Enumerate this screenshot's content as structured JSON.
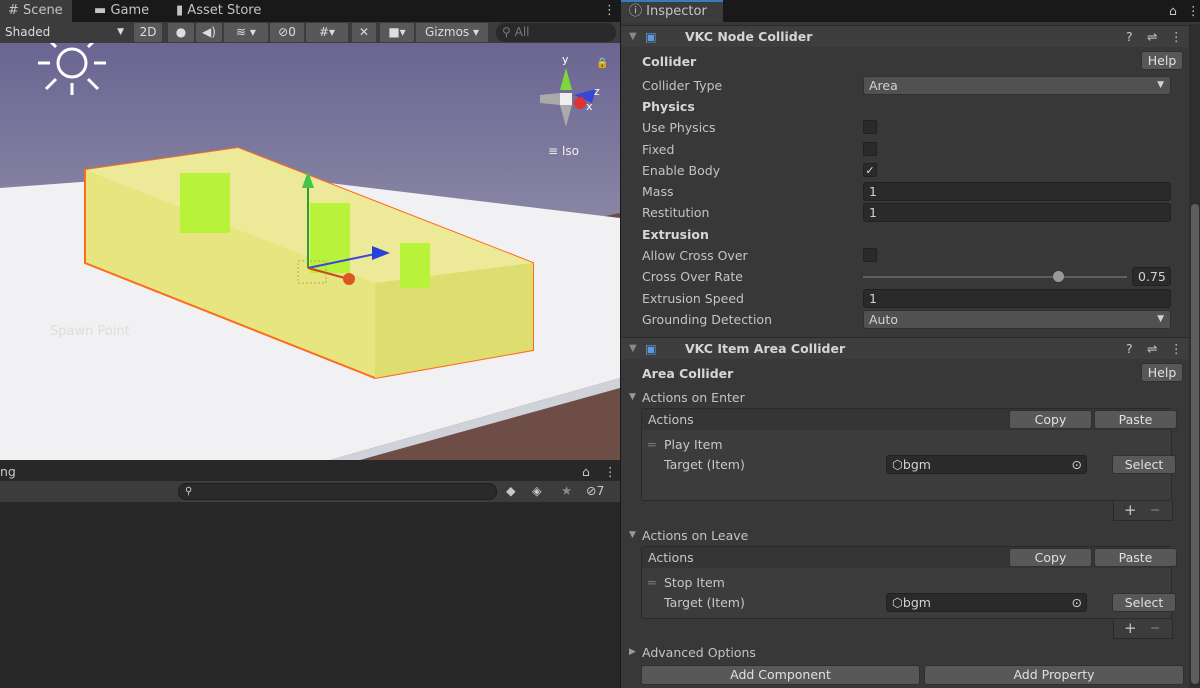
{
  "scene_tabs": [
    {
      "label": "Scene",
      "icon": "grid-icon"
    },
    {
      "label": "Game",
      "icon": "gamepad-icon"
    },
    {
      "label": "Asset Store",
      "icon": "bag-icon"
    }
  ],
  "scene_toolbar": {
    "shading": "Shaded",
    "mode_2d": "2D",
    "hidden_count": "0",
    "gizmos": "Gizmos",
    "search_placeholder": "All"
  },
  "scene_view": {
    "projection": "Iso",
    "axes": {
      "y": "y",
      "z": "z",
      "x": "x"
    },
    "object_label": "Spawn Point"
  },
  "hierarchy": {
    "title_fragment": "ng",
    "hidden_count": "7",
    "search_placeholder": ""
  },
  "inspector": {
    "tab": "Inspector",
    "node_collider": {
      "title": "VKC Node Collider",
      "collider_section": "Collider",
      "help": "Help",
      "collider_type_label": "Collider Type",
      "collider_type": "Area",
      "physics_section": "Physics",
      "use_physics_label": "Use Physics",
      "use_physics": false,
      "fixed_label": "Fixed",
      "fixed": false,
      "enable_body_label": "Enable Body",
      "enable_body": true,
      "mass_label": "Mass",
      "mass": "1",
      "restitution_label": "Restitution",
      "restitution": "1",
      "extrusion_section": "Extrusion",
      "allow_cross_over_label": "Allow Cross Over",
      "allow_cross_over": false,
      "cross_over_rate_label": "Cross Over Rate",
      "cross_over_rate": "0.75",
      "extrusion_speed_label": "Extrusion Speed",
      "extrusion_speed": "1",
      "grounding_label": "Grounding Detection",
      "grounding": "Auto"
    },
    "item_area_collider": {
      "title": "VKC Item Area Collider",
      "section": "Area Collider",
      "help": "Help",
      "enter": {
        "label": "Actions on Enter",
        "list_header": "Actions",
        "copy": "Copy",
        "paste": "Paste",
        "item": "Play Item",
        "target_label": "Target (Item)",
        "target": "bgm",
        "select": "Select"
      },
      "leave": {
        "label": "Actions on Leave",
        "list_header": "Actions",
        "copy": "Copy",
        "paste": "Paste",
        "item": "Stop Item",
        "target_label": "Target (Item)",
        "target": "bgm",
        "select": "Select"
      },
      "plus": "+",
      "minus": "−",
      "advanced": "Advanced Options"
    },
    "add_component": "Add Component",
    "add_property": "Add Property"
  }
}
